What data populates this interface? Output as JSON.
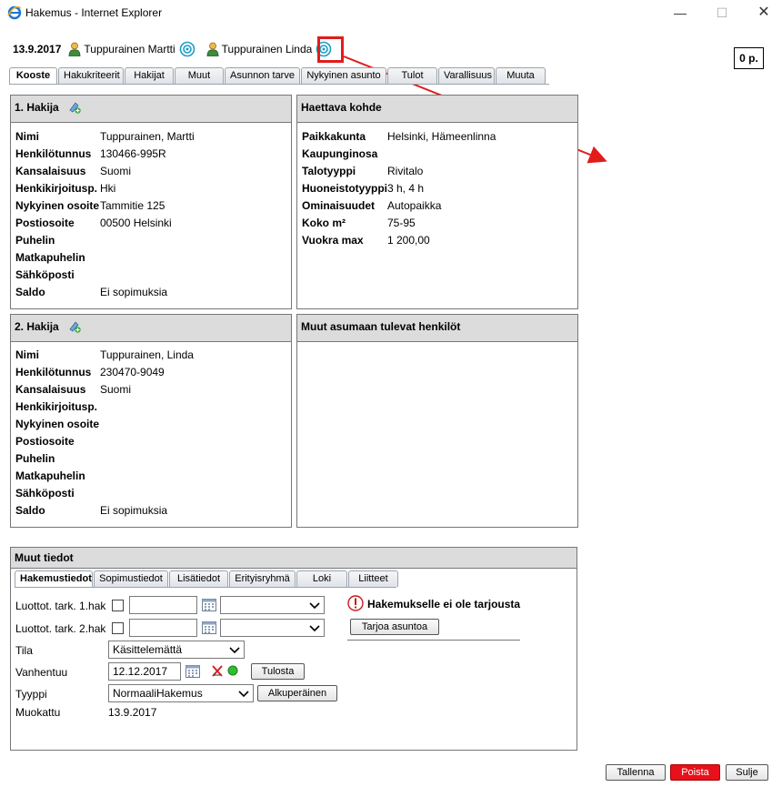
{
  "window": {
    "title": "Hakemus - Internet Explorer"
  },
  "header": {
    "date": "13.9.2017",
    "applicant1": "Tuppurainen Martti",
    "applicant2": "Tuppurainen Linda",
    "points": "0 p."
  },
  "tabs": [
    {
      "label": "Kooste"
    },
    {
      "label": "Hakukriteerit"
    },
    {
      "label": "Hakijat"
    },
    {
      "label": "Muut"
    },
    {
      "label": "Asunnon tarve"
    },
    {
      "label": "Nykyinen asunto"
    },
    {
      "label": "Tulot"
    },
    {
      "label": "Varallisuus"
    },
    {
      "label": "Muuta"
    }
  ],
  "hakija1": {
    "title": "1. Hakija",
    "rows": [
      {
        "k": "Nimi",
        "v": "Tuppurainen, Martti"
      },
      {
        "k": "Henkilötunnus",
        "v": "130466-995R"
      },
      {
        "k": "Kansalaisuus",
        "v": "Suomi"
      },
      {
        "k": "Henkikirjoitusp.",
        "v": "Hki"
      },
      {
        "k": "Nykyinen osoite",
        "v": "Tammitie 125"
      },
      {
        "k": "Postiosoite",
        "v": "00500 Helsinki"
      },
      {
        "k": "Puhelin",
        "v": ""
      },
      {
        "k": "Matkapuhelin",
        "v": ""
      },
      {
        "k": "Sähköposti",
        "v": ""
      },
      {
        "k": "Saldo",
        "v": "Ei sopimuksia"
      }
    ]
  },
  "haettava": {
    "title": "Haettava kohde",
    "rows": [
      {
        "k": "Paikkakunta",
        "v": "Helsinki, Hämeenlinna"
      },
      {
        "k": "Kaupunginosa",
        "v": ""
      },
      {
        "k": "Talotyyppi",
        "v": "Rivitalo"
      },
      {
        "k": "Huoneistotyyppi",
        "v": "3 h, 4 h"
      },
      {
        "k": "Ominaisuudet",
        "v": "Autopaikka"
      },
      {
        "k": "Koko m²",
        "v": "75-95"
      },
      {
        "k": "Vuokra max",
        "v": "1 200,00"
      }
    ]
  },
  "hakija2": {
    "title": "2. Hakija",
    "rows": [
      {
        "k": "Nimi",
        "v": "Tuppurainen, Linda"
      },
      {
        "k": "Henkilötunnus",
        "v": "230470-9049"
      },
      {
        "k": "Kansalaisuus",
        "v": "Suomi"
      },
      {
        "k": "Henkikirjoitusp.",
        "v": ""
      },
      {
        "k": "Nykyinen osoite",
        "v": ""
      },
      {
        "k": "Postiosoite",
        "v": ""
      },
      {
        "k": "Puhelin",
        "v": ""
      },
      {
        "k": "Matkapuhelin",
        "v": ""
      },
      {
        "k": "Sähköposti",
        "v": ""
      },
      {
        "k": "Saldo",
        "v": "Ei sopimuksia"
      }
    ]
  },
  "muut_henkilot": {
    "title": "Muut asumaan tulevat henkilöt"
  },
  "muut_tiedot": {
    "title": "Muut tiedot",
    "subtabs": [
      {
        "label": "Hakemustiedot"
      },
      {
        "label": "Sopimustiedot"
      },
      {
        "label": "Lisätiedot"
      },
      {
        "label": "Erityisryhmä"
      },
      {
        "label": "Loki"
      },
      {
        "label": "Liitteet"
      }
    ],
    "luottot1_label": "Luottot. tark. 1.hak",
    "luottot2_label": "Luottot. tark. 2.hak",
    "tila_label": "Tila",
    "tila_value": "Käsittelemättä",
    "vanhentuu_label": "Vanhentuu",
    "vanhentuu_value": "12.12.2017",
    "tulosta_button": "Tulosta",
    "tyyppi_label": "Tyyppi",
    "tyyppi_value": "NormaaliHakemus",
    "alkuperainen_button": "Alkuperäinen",
    "muokattu_label": "Muokattu",
    "muokattu_value": "13.9.2017",
    "warning_text": "Hakemukselle ei ole tarjousta",
    "tarjoa_button": "Tarjoa asuntoa"
  },
  "footer": {
    "tallenna": "Tallenna",
    "poista": "Poista",
    "sulje": "Sulje"
  },
  "colors": {
    "highlight": "#e21b1b",
    "delete_button": "#e8101a"
  }
}
